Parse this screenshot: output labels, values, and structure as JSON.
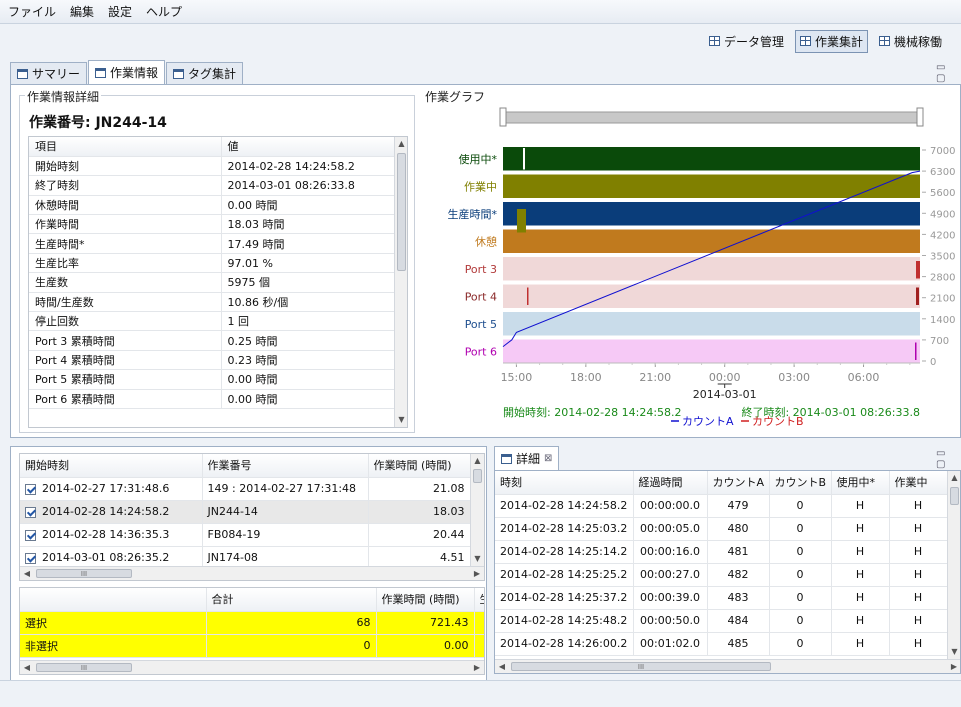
{
  "menu": [
    "ファイル",
    "編集",
    "設定",
    "ヘルプ"
  ],
  "perspectives": [
    {
      "label": "データ管理",
      "active": false
    },
    {
      "label": "作業集計",
      "active": true
    },
    {
      "label": "機械稼働",
      "active": false
    }
  ],
  "tabs": [
    {
      "label": "サマリー",
      "active": false
    },
    {
      "label": "作業情報",
      "active": true
    },
    {
      "label": "タグ集計",
      "active": false
    }
  ],
  "info": {
    "group_label": "作業情報詳細",
    "job_title": "作業番号: JN244-14",
    "col_item": "項目",
    "col_value": "値",
    "rows": [
      [
        "開始時刻",
        "2014-02-28 14:24:58.2"
      ],
      [
        "終了時刻",
        "2014-03-01 08:26:33.8"
      ],
      [
        "休憩時間",
        "0.00 時間"
      ],
      [
        "作業時間",
        "18.03 時間"
      ],
      [
        "生産時間*",
        "17.49 時間"
      ],
      [
        "生産比率",
        "97.01 %"
      ],
      [
        "生産数",
        "5975 個"
      ],
      [
        "時間/生産数",
        "10.86 秒/個"
      ],
      [
        "停止回数",
        "1 回"
      ],
      [
        "Port 3 累積時間",
        "0.25 時間"
      ],
      [
        "Port 4 累積時間",
        "0.23 時間"
      ],
      [
        "Port 5 累積時間",
        "0.00 時間"
      ],
      [
        "Port 6 累積時間",
        "0.00 時間"
      ]
    ]
  },
  "graph": {
    "group_label": "作業グラフ",
    "start_label": "開始時刻: 2014-02-28 14:24:58.2",
    "end_label": "終了時刻: 2014-03-01 08:26:33.8",
    "date_label": "2014-03-01"
  },
  "chart_data": {
    "type": "line",
    "title": "",
    "rows": [
      {
        "name": "使用中*",
        "color": "#0a4a0a",
        "label_color": "#0a4a0a"
      },
      {
        "name": "作業中",
        "color": "#808000",
        "label_color": "#808000"
      },
      {
        "name": "生産時間*",
        "color": "#0a3d7a",
        "label_color": "#0a3d7a"
      },
      {
        "name": "休憩",
        "color": "#c07a1e",
        "label_color": "#c07a1e"
      },
      {
        "name": "Port 3",
        "color": "#f0d8d8",
        "label_color": "#b23a3a"
      },
      {
        "name": "Port 4",
        "color": "#f0d8d8",
        "label_color": "#8b2a2a"
      },
      {
        "name": "Port 5",
        "color": "#c9dcea",
        "label_color": "#1f4f8f"
      },
      {
        "name": "Port 6",
        "color": "#f6c9f6",
        "label_color": "#b000b0"
      }
    ],
    "x_ticks": [
      "15:00",
      "18:00",
      "21:00",
      "00:00",
      "03:00",
      "06:00"
    ],
    "x_range_hours": [
      14.42,
      32.44
    ],
    "x_tick_hours": [
      15,
      18,
      21,
      24,
      27,
      30
    ],
    "y_ticks": [
      "7000",
      "6300",
      "5600",
      "4900",
      "4200",
      "3500",
      "2800",
      "2100",
      "1400",
      "700",
      "0"
    ],
    "ylim": [
      0,
      7000
    ],
    "series": [
      {
        "name": "カウントA",
        "color": "#1010d0",
        "x": [
          14.42,
          14.8,
          15.0,
          32.1,
          32.44
        ],
        "y": [
          479,
          700,
          950,
          6250,
          6300
        ]
      },
      {
        "name": "カウントB",
        "color": "#d02020",
        "x": [
          14.42,
          32.44
        ],
        "y": [
          0,
          0
        ]
      }
    ],
    "legend_placement": "bottom"
  },
  "jobs": {
    "headers": [
      "開始時刻",
      "作業番号",
      "作業時間 (時間)"
    ],
    "rows": [
      [
        "2014-02-27 17:31:48.6",
        "149 : 2014-02-27 17:31:48",
        "21.08"
      ],
      [
        "2014-02-28 14:24:58.2",
        "JN244-14",
        "18.03"
      ],
      [
        "2014-02-28 14:36:35.3",
        "FB084-19",
        "20.44"
      ],
      [
        "2014-03-01 08:26:35.2",
        "JN174-08",
        "4.51"
      ]
    ],
    "hscroll_label": "III"
  },
  "totals": {
    "headers": [
      "",
      "合計",
      "作業時間 (時間)",
      "生"
    ],
    "rows": [
      [
        "選択",
        "68",
        "721.43"
      ],
      [
        "非選択",
        "0",
        "0.00"
      ]
    ]
  },
  "detail": {
    "tab_label": "詳細",
    "close_glyph": "⊠",
    "headers": [
      "時刻",
      "経過時間",
      "カウントA",
      "カウントB",
      "使用中*",
      "作業中"
    ],
    "rows": [
      [
        "2014-02-28 14:24:58.2",
        "00:00:00.0",
        "479",
        "0",
        "H",
        "H"
      ],
      [
        "2014-02-28 14:25:03.2",
        "00:00:05.0",
        "480",
        "0",
        "H",
        "H"
      ],
      [
        "2014-02-28 14:25:14.2",
        "00:00:16.0",
        "481",
        "0",
        "H",
        "H"
      ],
      [
        "2014-02-28 14:25:25.2",
        "00:00:27.0",
        "482",
        "0",
        "H",
        "H"
      ],
      [
        "2014-02-28 14:25:37.2",
        "00:00:39.0",
        "483",
        "0",
        "H",
        "H"
      ],
      [
        "2014-02-28 14:25:48.2",
        "00:00:50.0",
        "484",
        "0",
        "H",
        "H"
      ],
      [
        "2014-02-28 14:26:00.2",
        "00:01:02.0",
        "485",
        "0",
        "H",
        "H"
      ]
    ],
    "hscroll_label": "III"
  },
  "minmax_glyph": "▭ ▢"
}
